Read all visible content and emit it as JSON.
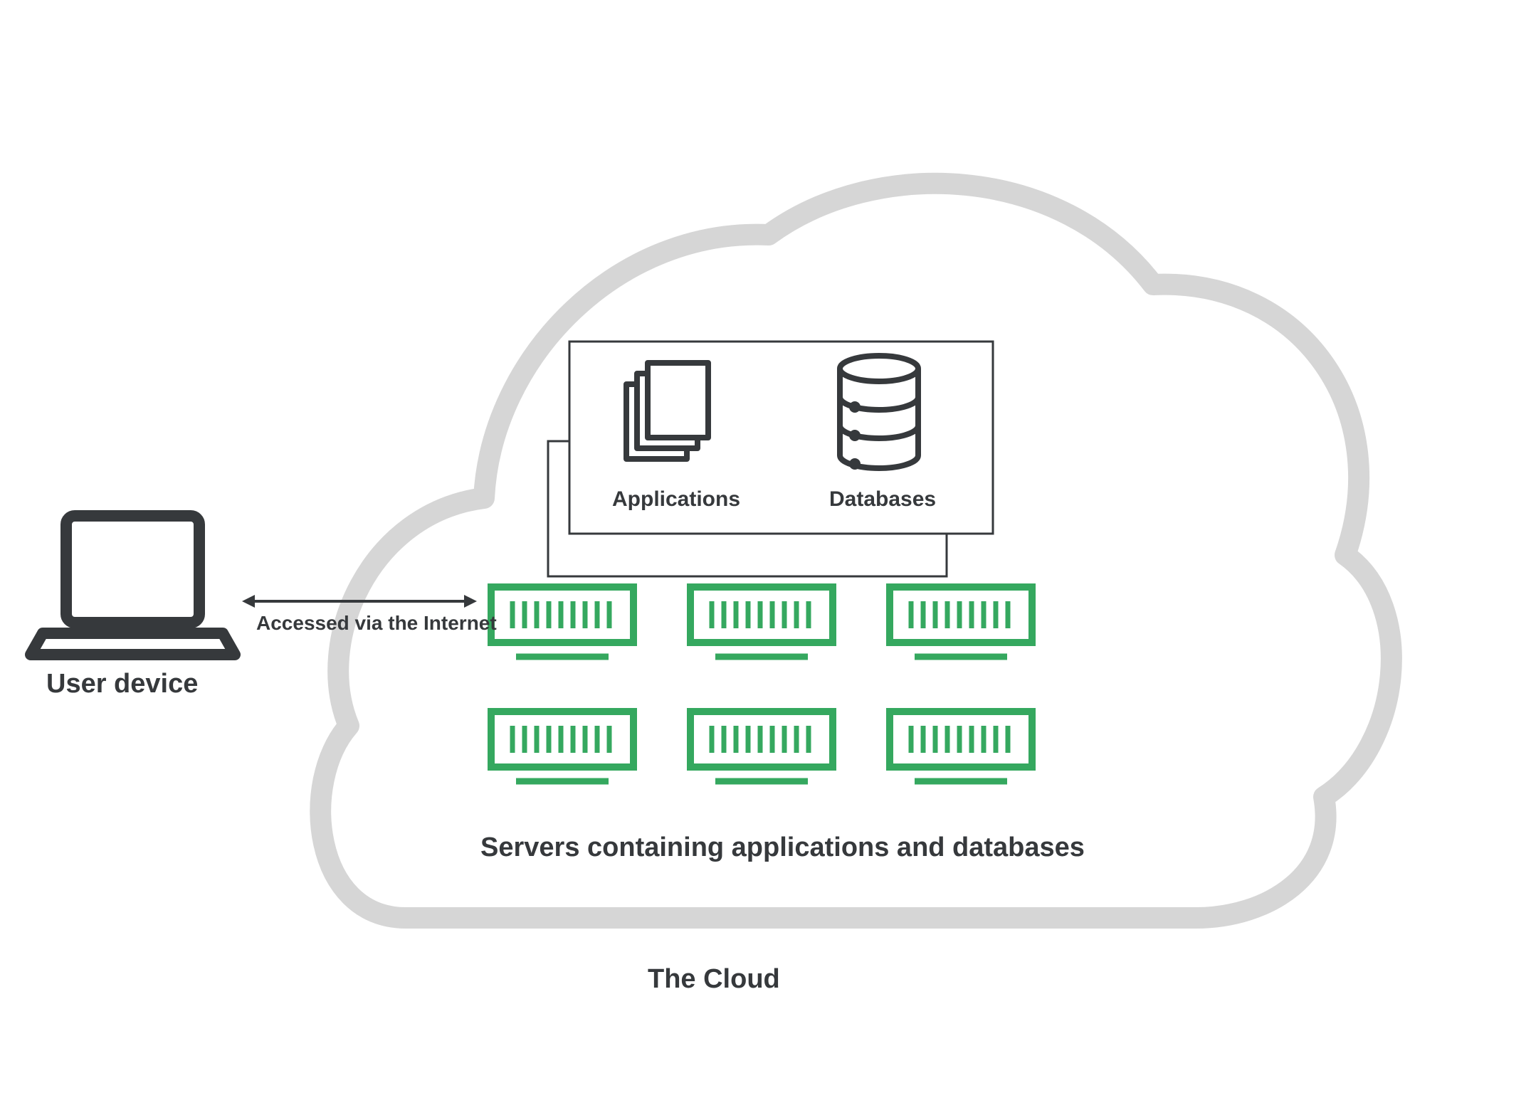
{
  "labels": {
    "user_device": "User device",
    "access": "Accessed via the Internet",
    "applications": "Applications",
    "databases": "Databases",
    "servers": "Servers containing applications and databases",
    "cloud": "The Cloud"
  },
  "colors": {
    "cloud_outline": "#d6d6d6",
    "text": "#36393c",
    "server_green": "#35a85f",
    "icon_dark": "#36393c"
  },
  "diagram": {
    "server_count": 6
  }
}
